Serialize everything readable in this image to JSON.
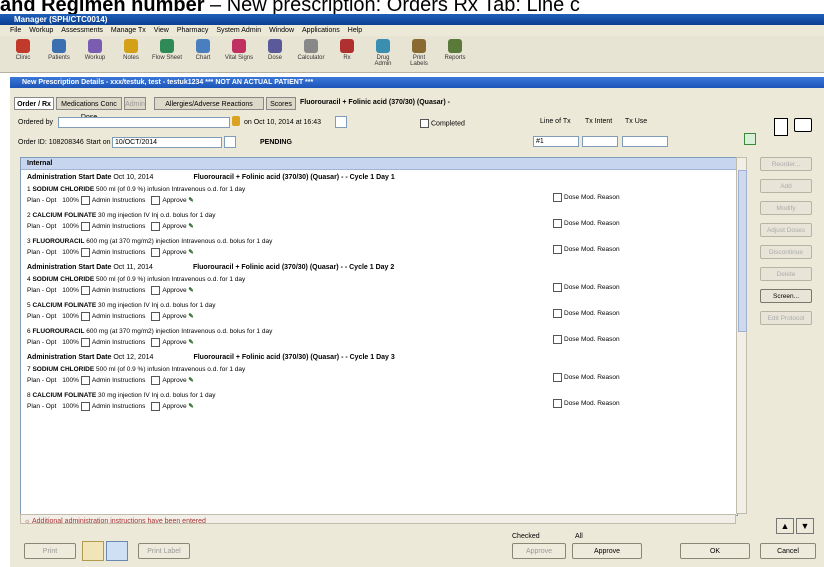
{
  "caption": {
    "bold": "and Regimen number",
    "rest": " – New prescription: Orders Rx Tab: Line c"
  },
  "app": {
    "title": "Manager (SPH/CTC0014)"
  },
  "menu": [
    "File",
    "Workup",
    "Assessments",
    "Manage Tx",
    "View",
    "Pharmacy",
    "System Admin",
    "Window",
    "Applications",
    "Help"
  ],
  "toolbar": [
    {
      "label": "Clinic",
      "icon": "clinic-icon",
      "color": "#c0392b"
    },
    {
      "label": "Patients",
      "icon": "patients-icon",
      "color": "#3a6fb0"
    },
    {
      "label": "Workup",
      "icon": "workup-icon",
      "color": "#7a5cb0"
    },
    {
      "label": "Notes",
      "icon": "notes-icon",
      "color": "#d4a017"
    },
    {
      "label": "Flow Sheet",
      "icon": "flowsheet-icon",
      "color": "#2e8b57"
    },
    {
      "label": "Chart",
      "icon": "chart-icon",
      "color": "#4a7fbf"
    },
    {
      "label": "Vital Signs",
      "icon": "vitals-icon",
      "color": "#c03060"
    },
    {
      "label": "Dose",
      "icon": "dose-icon",
      "color": "#5a5a9a"
    },
    {
      "label": "Calculator",
      "icon": "calculator-icon",
      "color": "#888888"
    },
    {
      "label": "Rx",
      "icon": "rx-icon",
      "color": "#b03030"
    },
    {
      "label": "Drug Admin",
      "icon": "drug-admin-icon",
      "color": "#3a8fb0"
    },
    {
      "label": "Print Labels",
      "icon": "print-labels-icon",
      "color": "#8a6a30"
    },
    {
      "label": "Reports",
      "icon": "reports-icon",
      "color": "#5a7a3a"
    }
  ],
  "dialog": {
    "title": "New Prescription Details - xxx/testuk, test - testuk1234 *** NOT AN ACTUAL PATIENT ***",
    "tabs": [
      "Order / Rx",
      "Medications Conc Dose",
      "Admin",
      "Allergies/Adverse Reactions",
      "Scores"
    ],
    "regimen": "Fluorouracil + Folinic acid (370/30) (Quasar) -"
  },
  "form": {
    "ordered_by_label": "Ordered by",
    "ordered_by_value": "",
    "on_text": "on Oct 10, 2014  at 16:43",
    "completed_label": "Completed",
    "order_id": "Order ID: 108208346",
    "start_label": "Start on",
    "start_value": "10/OCT/2014",
    "status": "PENDING",
    "line_label": "Line of Tx",
    "line_value": "#1",
    "intent_label": "Tx Intent",
    "use_label": "Tx Use"
  },
  "list": {
    "header": "Internal",
    "groups": [
      {
        "admin": "Administration Start Date",
        "date": "Oct 10, 2014",
        "cycle": "Fluorouracil + Folinic acid (370/30) (Quasar) - - Cycle 1 Day 1",
        "items": [
          {
            "num": "1",
            "drug": "SODIUM CHLORIDE",
            "detail": "500 ml (of 0.9 %) infusion Intravenous o.d. for 1 day",
            "plan": "Plan - Opt",
            "pct": "100%",
            "instr": "Admin Instructions",
            "approve": "Approve",
            "dose": "Dose Mod. Reason"
          },
          {
            "num": "2",
            "drug": "CALCIUM FOLINATE",
            "detail": "30 mg injection IV Inj o.d. bolus for 1 day",
            "plan": "Plan - Opt",
            "pct": "100%",
            "instr": "Admin Instructions",
            "approve": "Approve",
            "dose": "Dose Mod. Reason"
          },
          {
            "num": "3",
            "drug": "FLUOROURACIL",
            "detail": "600 mg (at 370 mg/m2) injection Intravenous o.d. bolus for 1 day",
            "plan": "Plan - Opt",
            "pct": "100%",
            "instr": "Admin Instructions",
            "approve": "Approve",
            "dose": "Dose Mod. Reason"
          }
        ]
      },
      {
        "admin": "Administration Start Date",
        "date": "Oct 11, 2014",
        "cycle": "Fluorouracil + Folinic acid (370/30) (Quasar) - - Cycle 1 Day 2",
        "items": [
          {
            "num": "4",
            "drug": "SODIUM CHLORIDE",
            "detail": "500 ml (of 0.9 %) infusion Intravenous o.d. for 1 day",
            "plan": "Plan - Opt",
            "pct": "100%",
            "instr": "Admin Instructions",
            "approve": "Approve",
            "dose": "Dose Mod. Reason"
          },
          {
            "num": "5",
            "drug": "CALCIUM FOLINATE",
            "detail": "30 mg injection IV Inj o.d. bolus for 1 day",
            "plan": "Plan - Opt",
            "pct": "100%",
            "instr": "Admin Instructions",
            "approve": "Approve",
            "dose": "Dose Mod. Reason"
          },
          {
            "num": "6",
            "drug": "FLUOROURACIL",
            "detail": "600 mg (at 370 mg/m2) injection Intravenous o.d. bolus for 1 day",
            "plan": "Plan - Opt",
            "pct": "100%",
            "instr": "Admin Instructions",
            "approve": "Approve",
            "dose": "Dose Mod. Reason"
          }
        ]
      },
      {
        "admin": "Administration Start Date",
        "date": "Oct 12, 2014",
        "cycle": "Fluorouracil + Folinic acid (370/30) (Quasar) - - Cycle 1 Day 3",
        "items": [
          {
            "num": "7",
            "drug": "SODIUM CHLORIDE",
            "detail": "500 ml (of 0.9 %) infusion Intravenous o.d. for 1 day",
            "plan": "Plan - Opt",
            "pct": "100%",
            "instr": "Admin Instructions",
            "approve": "Approve",
            "dose": "Dose Mod. Reason"
          },
          {
            "num": "8",
            "drug": "CALCIUM FOLINATE",
            "detail": "30 mg injection IV Inj o.d. bolus for 1 day",
            "plan": "Plan - Opt",
            "pct": "100%",
            "instr": "Admin Instructions",
            "approve": "Approve",
            "dose": "Dose Mod. Reason"
          }
        ]
      }
    ]
  },
  "side_buttons": [
    {
      "label": "Reorder...",
      "enabled": false
    },
    {
      "label": "Add",
      "enabled": false
    },
    {
      "label": "Modify",
      "enabled": false
    },
    {
      "label": "Adjust Doses",
      "enabled": false
    },
    {
      "label": "Discontinue",
      "enabled": false
    },
    {
      "label": "Delete",
      "enabled": false
    },
    {
      "label": "Screen...",
      "enabled": true
    },
    {
      "label": "Edit Protocol",
      "enabled": false
    }
  ],
  "footer": {
    "note": "Additional administration instructions have been entered",
    "print": "Print",
    "print_label": "Print Label",
    "checked_label": "Checked",
    "all_label": "All",
    "approve_all": "Approve",
    "approve": "Approve",
    "ok": "OK",
    "cancel": "Cancel"
  }
}
